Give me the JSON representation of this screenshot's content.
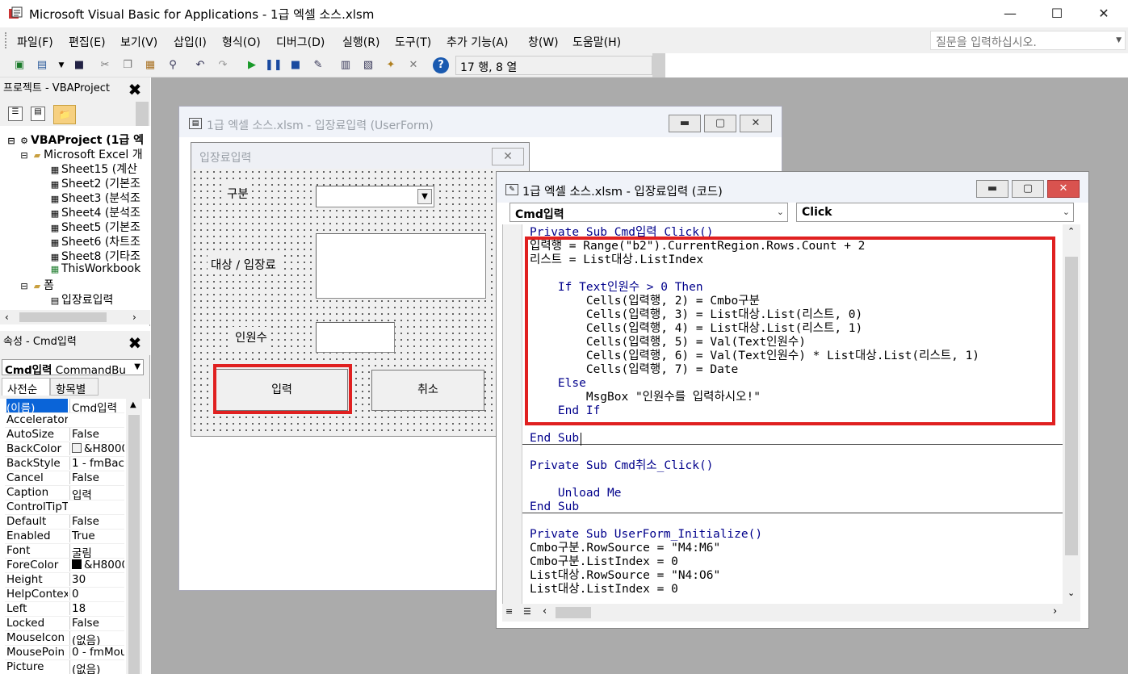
{
  "window": {
    "title": "Microsoft Visual Basic for Applications - 1급 엑셀 소스.xlsm",
    "min": "—",
    "max": "☐",
    "close": "✕"
  },
  "menu": {
    "items": [
      "파일(F)",
      "편집(E)",
      "보기(V)",
      "삽입(I)",
      "형식(O)",
      "디버그(D)",
      "실행(R)",
      "도구(T)",
      "추가 기능(A)",
      "창(W)",
      "도움말(H)"
    ],
    "ask_placeholder": "질문을 입력하십시오."
  },
  "toolbar": {
    "position": "17 행, 8 열"
  },
  "project": {
    "title": "프로젝트 - VBAProject",
    "close": "✖",
    "tree": [
      {
        "text": "VBAProject (1급 엑",
        "bold": true
      },
      {
        "text": "Microsoft Excel 개",
        "bold": false
      },
      {
        "text": "Sheet15 (계산",
        "bold": false
      },
      {
        "text": "Sheet2 (기본조",
        "bold": false
      },
      {
        "text": "Sheet3 (분석조",
        "bold": false
      },
      {
        "text": "Sheet4 (분석조",
        "bold": false
      },
      {
        "text": "Sheet5 (기본조",
        "bold": false
      },
      {
        "text": "Sheet6 (차트조",
        "bold": false
      },
      {
        "text": "Sheet8 (기타조",
        "bold": false
      },
      {
        "text": "ThisWorkbook",
        "bold": false
      },
      {
        "text": "폼",
        "bold": false
      },
      {
        "text": "입장료입력",
        "bold": false
      }
    ]
  },
  "properties": {
    "title": "속성 - Cmd입력",
    "close": "✖",
    "object": "Cmd입력",
    "object_type": "CommandBu",
    "tabs": [
      "사전순",
      "항목별"
    ],
    "rows": [
      {
        "name": "(이름)",
        "value": "Cmd입력"
      },
      {
        "name": "Accelerator",
        "value": ""
      },
      {
        "name": "AutoSize",
        "value": "False"
      },
      {
        "name": "BackColor",
        "value": "&H8000"
      },
      {
        "name": "BackStyle",
        "value": "1 - fmBac"
      },
      {
        "name": "Cancel",
        "value": "False"
      },
      {
        "name": "Caption",
        "value": "입력"
      },
      {
        "name": "ControlTipT",
        "value": ""
      },
      {
        "name": "Default",
        "value": "False"
      },
      {
        "name": "Enabled",
        "value": "True"
      },
      {
        "name": "Font",
        "value": "굴림"
      },
      {
        "name": "ForeColor",
        "value": "&H8000"
      },
      {
        "name": "Height",
        "value": "30"
      },
      {
        "name": "HelpContex",
        "value": "0"
      },
      {
        "name": "Left",
        "value": "18"
      },
      {
        "name": "Locked",
        "value": "False"
      },
      {
        "name": "MouseIcon",
        "value": "(없음)"
      },
      {
        "name": "MousePoin",
        "value": "0 - fmMou"
      },
      {
        "name": "Picture",
        "value": "(없음)"
      }
    ]
  },
  "userform_window": {
    "title": "1급 엑셀 소스.xlsm - 입장료입력 (UserForm)"
  },
  "form": {
    "title": "입장료입력",
    "close": "✕",
    "label_category": "구분",
    "label_target": "대상 / 입장료",
    "label_count": "인원수",
    "btn_submit": "입력",
    "btn_cancel": "취소"
  },
  "code_window": {
    "title": "1급 엑셀 소스.xlsm - 입장료입력 (코드)",
    "object_combo": "Cmd입력",
    "proc_combo": "Click"
  },
  "code": {
    "lines": [
      "Private Sub Cmd입력_Click()",
      "입력행 = Range(\"b2\").CurrentRegion.Rows.Count + 2",
      "리스트 = List대상.ListIndex",
      "",
      "    If Text인원수 > 0 Then",
      "        Cells(입력행, 2) = Cmbo구분",
      "        Cells(입력행, 3) = List대상.List(리스트, 0)",
      "        Cells(입력행, 4) = List대상.List(리스트, 1)",
      "        Cells(입력행, 5) = Val(Text인원수)",
      "        Cells(입력행, 6) = Val(Text인원수) * List대상.List(리스트, 1)",
      "        Cells(입력행, 7) = Date",
      "    Else",
      "        MsgBox \"인원수를 입력하시오!\"",
      "    End If",
      "",
      "End Sub",
      "",
      "Private Sub Cmd취소_Click()",
      "",
      "    Unload Me",
      "End Sub",
      "",
      "Private Sub UserForm_Initialize()",
      "Cmbo구분.RowSource = \"M4:M6\"",
      "Cmbo구분.ListIndex = 0",
      "List대상.RowSource = \"N4:O6\"",
      "List대상.ListIndex = 0"
    ]
  },
  "colors": {
    "highlight": "#e02020",
    "keyword": "#00008b",
    "workspace": "#ababab"
  }
}
